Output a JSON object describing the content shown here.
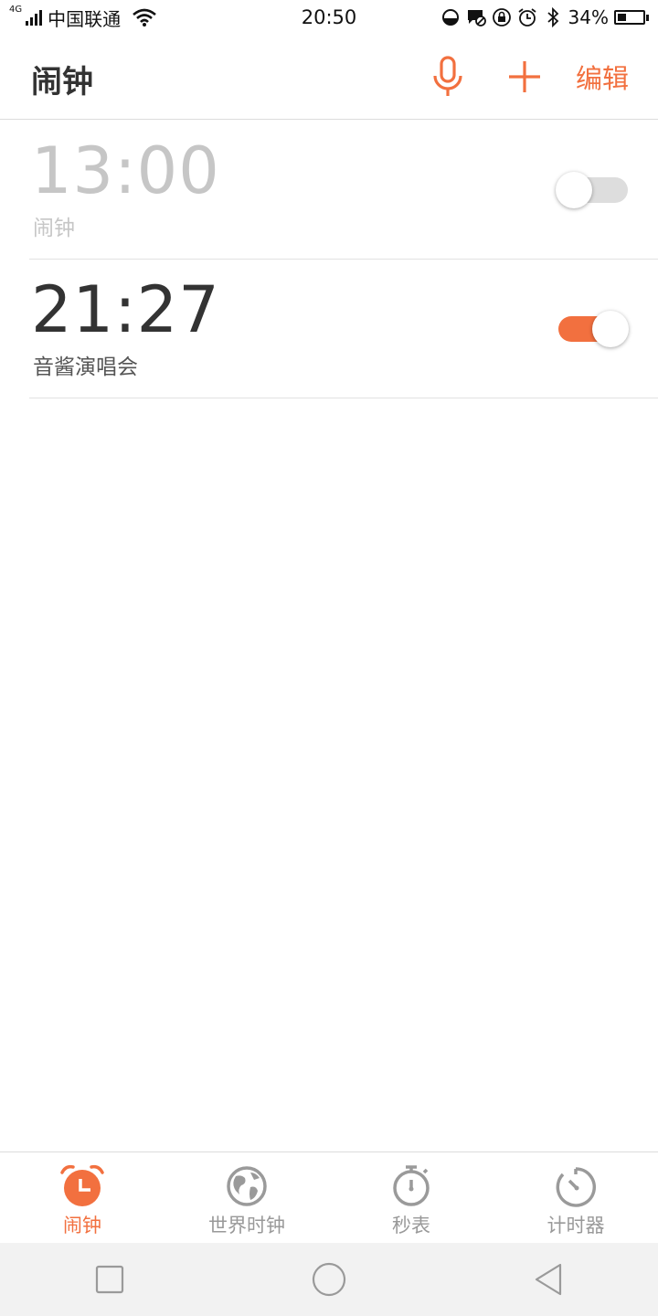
{
  "status_bar": {
    "network_type": "4G",
    "carrier": "中国联通",
    "time": "20:50",
    "battery_percent": "34%",
    "battery_level": 0.34
  },
  "header": {
    "title": "闹钟",
    "edit_label": "编辑",
    "accent_color": "#f2703f"
  },
  "alarms": [
    {
      "time": "13:00",
      "label": "闹钟",
      "enabled": false
    },
    {
      "time": "21:27",
      "label": "音酱演唱会",
      "enabled": true
    }
  ],
  "tabs": [
    {
      "label": "闹钟",
      "icon": "alarm-clock-icon",
      "active": true
    },
    {
      "label": "世界时钟",
      "icon": "globe-icon",
      "active": false
    },
    {
      "label": "秒表",
      "icon": "stopwatch-icon",
      "active": false
    },
    {
      "label": "计时器",
      "icon": "timer-icon",
      "active": false
    }
  ],
  "nav": [
    "recent-apps-icon",
    "home-icon",
    "back-icon"
  ]
}
